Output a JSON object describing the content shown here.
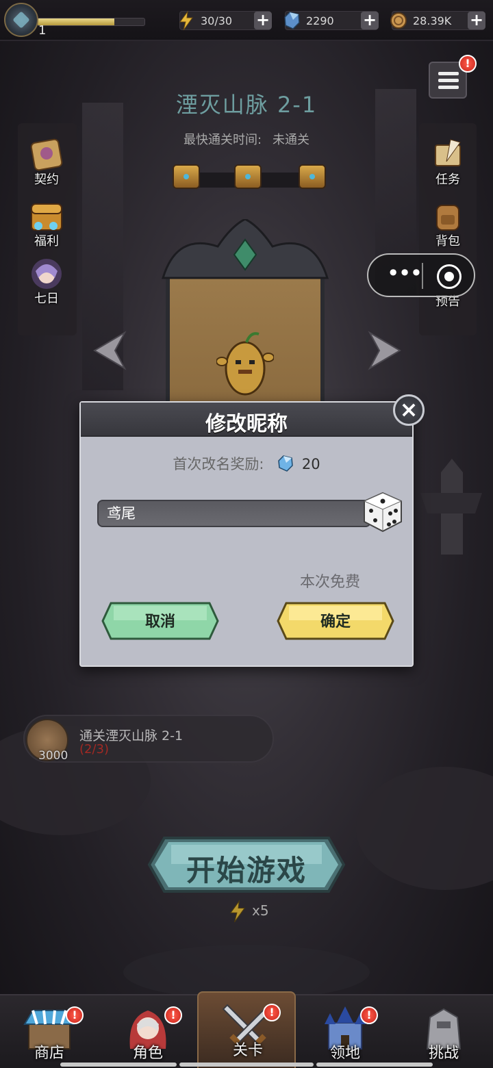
{
  "top_bar": {
    "level": "1",
    "xp_fraction": 0.72,
    "energy": "30/30",
    "gems": "2290",
    "coins": "28.39K",
    "plus_symbol": "+"
  },
  "stage": {
    "title": "湮灭山脉 2-1",
    "best_time_label": "最快通关时间:",
    "best_time_value": "未通关"
  },
  "side_left": [
    {
      "label": "契约",
      "icon": "contract-scroll-icon"
    },
    {
      "label": "福利",
      "icon": "treasure-chest-icon"
    },
    {
      "label": "七日",
      "icon": "heroine-portrait-icon"
    }
  ],
  "side_right": [
    {
      "label": "任务",
      "icon": "quest-quill-icon"
    },
    {
      "label": "背包",
      "icon": "backpack-icon"
    },
    {
      "label": "预告",
      "icon": "preview-icon"
    }
  ],
  "badge_symbol": "!",
  "capsule": {
    "more_symbol": "•••"
  },
  "dialog": {
    "title": "修改昵称",
    "close_symbol": "×",
    "reward_label": "首次改名奖励:",
    "reward_amount": "20",
    "nickname_value": "鸢尾",
    "free_label": "本次免费",
    "cancel_label": "取消",
    "confirm_label": "确定"
  },
  "quest": {
    "reward_amount": "3000",
    "title": "通关湮灭山脉 2-1",
    "progress": "(2/3)"
  },
  "start": {
    "label": "开始游戏",
    "energy_cost": "x5"
  },
  "bottom_nav": [
    {
      "label": "商店",
      "icon": "shop-stall-icon",
      "badge": true
    },
    {
      "label": "角色",
      "icon": "character-icon",
      "badge": true
    },
    {
      "label": "关卡",
      "icon": "crossed-swords-icon",
      "badge": true,
      "active": true
    },
    {
      "label": "领地",
      "icon": "castle-icon",
      "badge": true
    },
    {
      "label": "挑战",
      "icon": "challenge-icon",
      "badge": false
    }
  ],
  "colors": {
    "accent_gold": "#e9d78a",
    "title_teal": "#6e9ea0",
    "badge_red": "#d8302a",
    "progress_red": "#c02a22"
  }
}
